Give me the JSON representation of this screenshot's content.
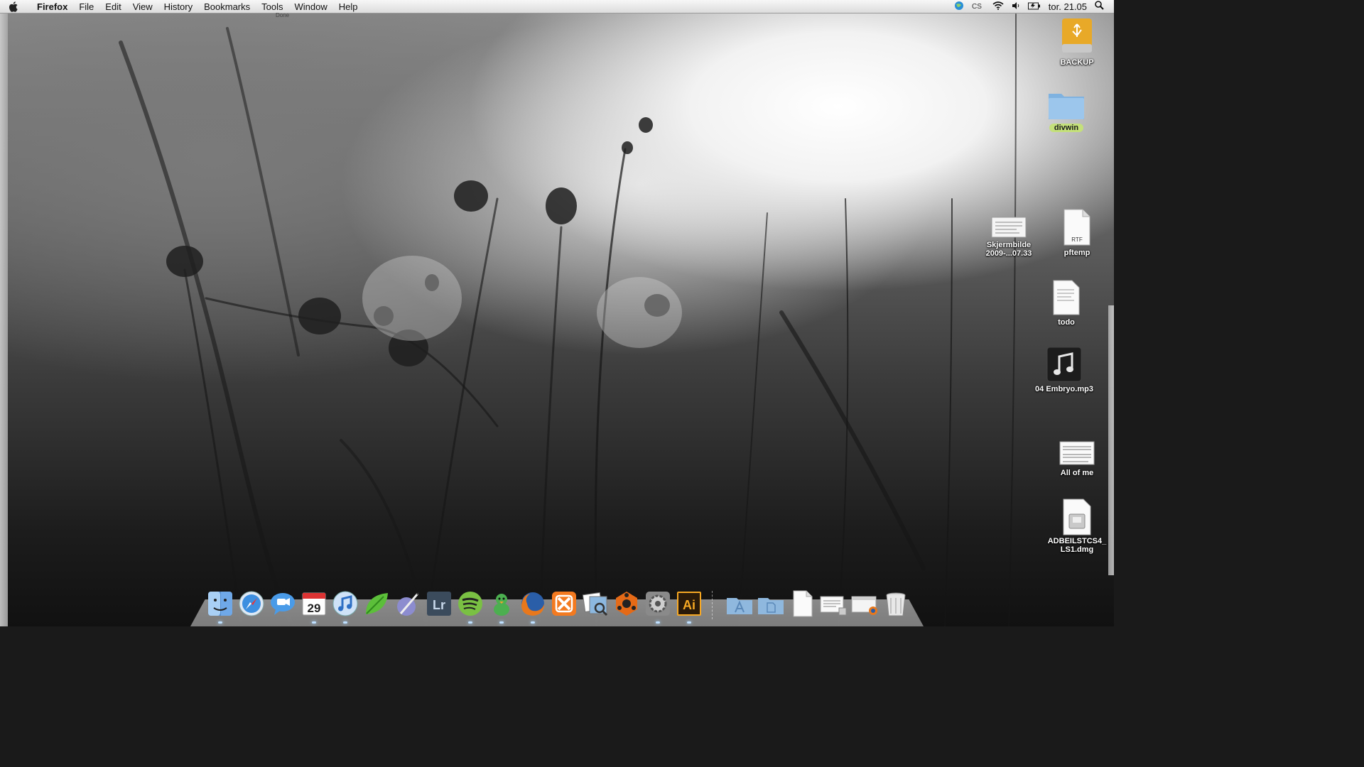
{
  "menubar": {
    "app_name": "Firefox",
    "menus": [
      "File",
      "Edit",
      "View",
      "History",
      "Bookmarks",
      "Tools",
      "Window",
      "Help"
    ],
    "clock": "tor. 21.05",
    "status_text": "Done"
  },
  "desktop_icons": [
    {
      "label": "BACKUP",
      "icon": "usb-drive-icon"
    },
    {
      "label": "divwin",
      "icon": "folder-icon"
    },
    {
      "label": "Skjermbilde 2009-...07.33",
      "icon": "screenshot-file-icon"
    },
    {
      "label": "pftemp",
      "icon": "rtf-document-icon",
      "badge": "RTF"
    },
    {
      "label": "todo",
      "icon": "text-document-icon"
    },
    {
      "label": "04 Embryo.mp3",
      "icon": "music-file-icon"
    },
    {
      "label": "All of me",
      "icon": "sheet-music-file-icon"
    },
    {
      "label": "ADBEILSTCS4_LS1.dmg",
      "icon": "disk-image-icon"
    }
  ],
  "calendar_day": "29",
  "lightroom_label": "Lr",
  "illustrator_label": "Ai",
  "dock": {
    "apps": [
      "finder",
      "safari",
      "ichat",
      "ical",
      "itunes",
      "coda",
      "script-editor",
      "lightroom",
      "spotify",
      "adium",
      "firefox",
      "xampp",
      "preview",
      "reason",
      "system-preferences",
      "illustrator"
    ],
    "stacks": [
      "applications-folder",
      "documents-folder",
      "blank-document",
      "screenshot-stack",
      "firefox-window",
      "trash"
    ]
  }
}
